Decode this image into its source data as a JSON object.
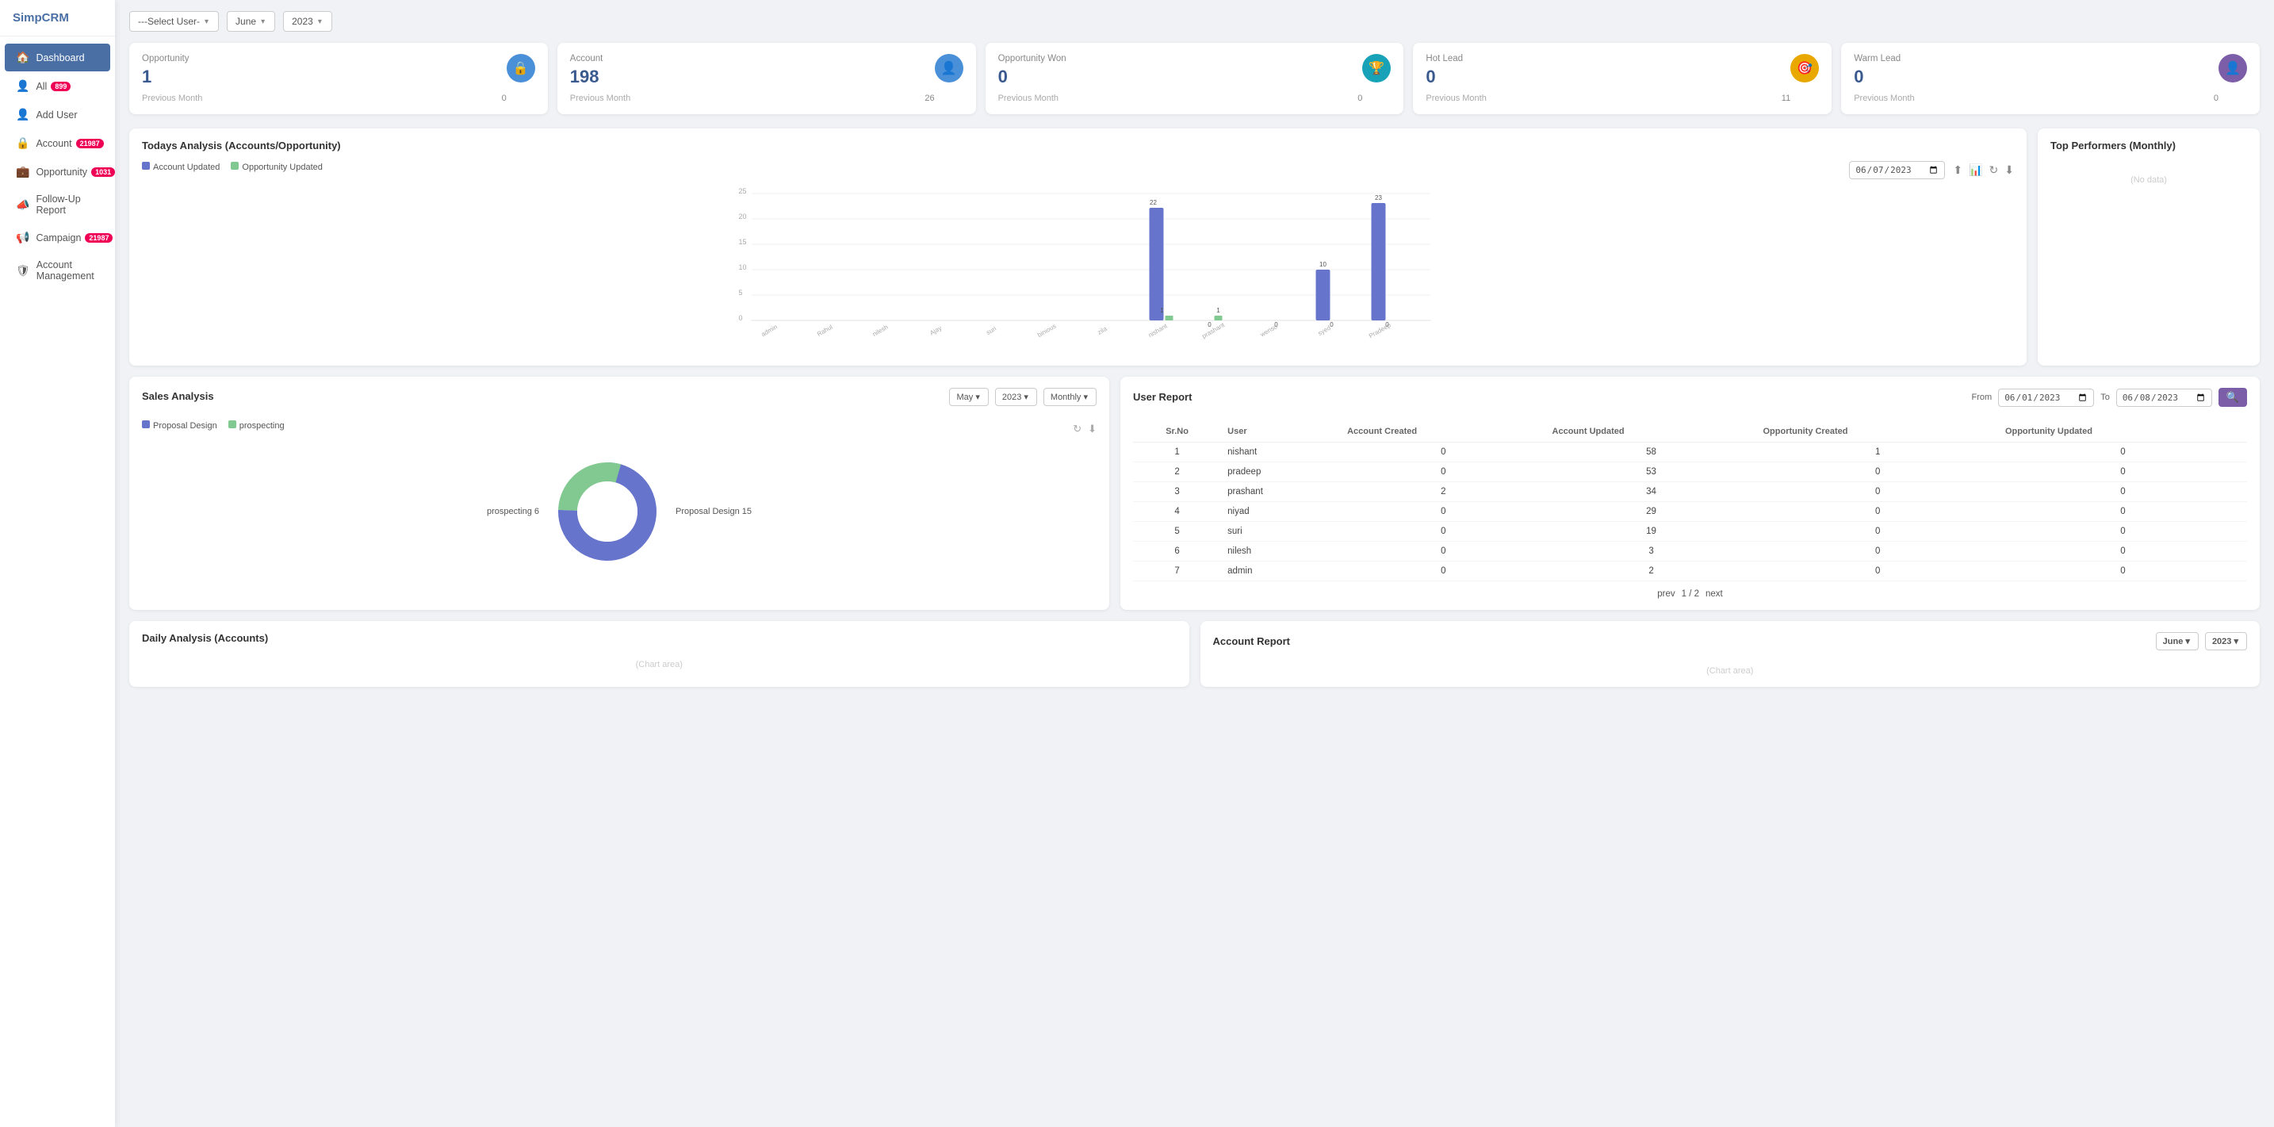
{
  "app": {
    "name": "SimpCRM"
  },
  "sidebar": {
    "items": [
      {
        "id": "dashboard",
        "label": "Dashboard",
        "icon": "🏠",
        "active": true,
        "badge": null
      },
      {
        "id": "all",
        "label": "All",
        "icon": "👤",
        "badge": "899"
      },
      {
        "id": "add-user",
        "label": "Add User",
        "icon": "👤",
        "badge": null
      },
      {
        "id": "account",
        "label": "Account",
        "icon": "🔒",
        "badge": "21987"
      },
      {
        "id": "opportunity",
        "label": "Opportunity",
        "icon": "💼",
        "badge": "1031"
      },
      {
        "id": "follow-up",
        "label": "Follow-Up Report",
        "icon": "📣",
        "badge": null
      },
      {
        "id": "campaign",
        "label": "Campaign",
        "icon": "📢",
        "badge": "21987"
      },
      {
        "id": "account-mgmt",
        "label": "Account Management",
        "icon": "🛡",
        "badge": null
      }
    ]
  },
  "filters": {
    "user": "---Select User-",
    "month": "June",
    "year": "2023"
  },
  "summary_cards": [
    {
      "id": "opportunity",
      "title": "Opportunity",
      "value": "1",
      "prev_label": "Previous Month",
      "prev_value": "0",
      "icon": "🔒",
      "icon_class": "blue"
    },
    {
      "id": "account",
      "title": "Account",
      "value": "198",
      "prev_label": "Previous Month",
      "prev_value": "26",
      "icon": "👤",
      "icon_class": "blue"
    },
    {
      "id": "opportunity-won",
      "title": "Opportunity Won",
      "value": "0",
      "prev_label": "Previous Month",
      "prev_value": "0",
      "icon": "🏆",
      "icon_class": "teal"
    },
    {
      "id": "hot-lead",
      "title": "Hot Lead",
      "value": "0",
      "prev_label": "Previous Month",
      "prev_value": "11",
      "icon": "🎯",
      "icon_class": "gold"
    },
    {
      "id": "warm-lead",
      "title": "Warm Lead",
      "value": "0",
      "prev_label": "Previous Month",
      "prev_value": "0",
      "icon": "👤",
      "icon_class": "purple"
    }
  ],
  "todays_analysis": {
    "title": "Todays Analysis (Accounts/Opportunity)",
    "date": "07/06/2023",
    "legend": [
      {
        "label": "Account Updated",
        "color": "blue"
      },
      {
        "label": "Opportunity Updated",
        "color": "green"
      }
    ],
    "bars": [
      {
        "name": "admin",
        "account": 0,
        "opportunity": 0
      },
      {
        "name": "Rahul",
        "account": 0,
        "opportunity": 0
      },
      {
        "name": "nilesh",
        "account": 0,
        "opportunity": 0
      },
      {
        "name": "Ajay",
        "account": 0,
        "opportunity": 0
      },
      {
        "name": "suri",
        "account": 0,
        "opportunity": 0
      },
      {
        "name": "binious",
        "account": 0,
        "opportunity": 0
      },
      {
        "name": "zila",
        "account": 0,
        "opportunity": 0
      },
      {
        "name": "nishant",
        "account": 22,
        "opportunity": 1
      },
      {
        "name": "prashant",
        "account": 0,
        "opportunity": 1
      },
      {
        "name": "wenso",
        "account": 0,
        "opportunity": 0
      },
      {
        "name": "syed",
        "account": 10,
        "opportunity": 0
      },
      {
        "name": "Pradeep",
        "account": 23,
        "opportunity": 0
      }
    ],
    "y_max": 25
  },
  "top_performers": {
    "title": "Top Performers (Monthly)"
  },
  "sales_analysis": {
    "title": "Sales Analysis",
    "filters": {
      "month": "May",
      "year": "2023",
      "period": "Monthly"
    },
    "legend": [
      {
        "label": "Proposal Design",
        "color": "blue"
      },
      {
        "label": "prospecting",
        "color": "green"
      }
    ],
    "donut": {
      "proposal_design_val": 15,
      "prospecting_val": 6,
      "proposal_label": "Proposal Design 15",
      "prospecting_label": "prospecting 6"
    }
  },
  "user_report": {
    "title": "User Report",
    "filters": {
      "from_label": "From",
      "from_date": "01/06/2023",
      "to_label": "To",
      "to_date": "08/06/2023"
    },
    "columns": [
      "Sr.No",
      "User",
      "Account Created",
      "Account Updated",
      "Opportunity Created",
      "Opportunity Updated"
    ],
    "rows": [
      {
        "sr": 1,
        "user": "nishant",
        "ac": 0,
        "au": 58,
        "oc": 1,
        "ou": 0
      },
      {
        "sr": 2,
        "user": "pradeep",
        "ac": 0,
        "au": 53,
        "oc": 0,
        "ou": 0
      },
      {
        "sr": 3,
        "user": "prashant",
        "ac": 2,
        "au": 34,
        "oc": 0,
        "ou": 0
      },
      {
        "sr": 4,
        "user": "niyad",
        "ac": 0,
        "au": 29,
        "oc": 0,
        "ou": 0
      },
      {
        "sr": 5,
        "user": "suri",
        "ac": 0,
        "au": 19,
        "oc": 0,
        "ou": 0
      },
      {
        "sr": 6,
        "user": "nilesh",
        "ac": 0,
        "au": 3,
        "oc": 0,
        "ou": 0
      },
      {
        "sr": 7,
        "user": "admin",
        "ac": 0,
        "au": 2,
        "oc": 0,
        "ou": 0
      }
    ],
    "pagination": {
      "prev": "prev",
      "current": "1 / 2",
      "next": "next"
    }
  },
  "daily_analysis": {
    "title": "Daily Analysis (Accounts)"
  },
  "account_report": {
    "title": "Account Report",
    "filters": {
      "month": "June",
      "year": "2023"
    }
  }
}
